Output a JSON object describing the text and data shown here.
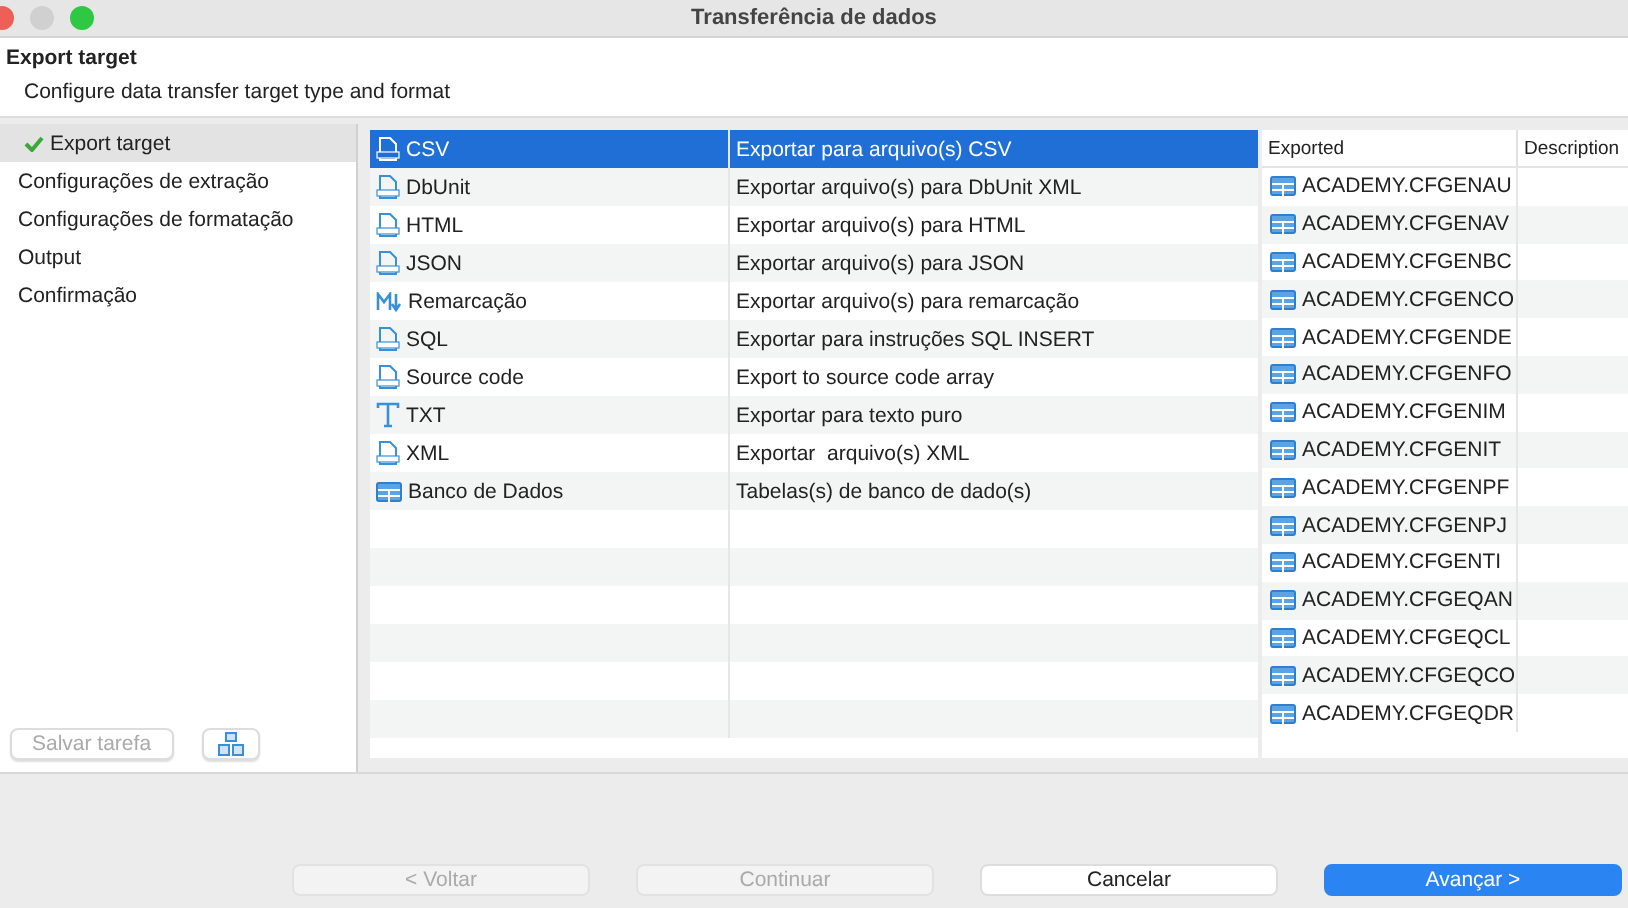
{
  "window": {
    "title": "Transferência de dados"
  },
  "header": {
    "title": "Export target",
    "subtitle": "Configure data transfer target type and format"
  },
  "steps": [
    {
      "label": "Export target",
      "selected": true,
      "checked": true
    },
    {
      "label": "Configurações de extração",
      "selected": false,
      "checked": false
    },
    {
      "label": "Configurações de formatação",
      "selected": false,
      "checked": false
    },
    {
      "label": "Output",
      "selected": false,
      "checked": false
    },
    {
      "label": "Confirmação",
      "selected": false,
      "checked": false
    }
  ],
  "task_buttons": {
    "save": {
      "label": "Salvar tarefa",
      "disabled": true
    }
  },
  "formats": [
    {
      "name": "CSV",
      "description": "Exportar para arquivo(s) CSV",
      "kind": "file",
      "selected": true
    },
    {
      "name": "DbUnit",
      "description": "Exportar arquivo(s) para DbUnit XML",
      "kind": "file",
      "selected": false
    },
    {
      "name": "HTML",
      "description": "Exportar arquivo(s) para HTML",
      "kind": "file",
      "selected": false
    },
    {
      "name": "JSON",
      "description": "Exportar arquivo(s) para JSON",
      "kind": "file",
      "selected": false
    },
    {
      "name": "Remarcação",
      "description": "Exportar arquivo(s) para remarcação",
      "kind": "markdown",
      "selected": false
    },
    {
      "name": "SQL",
      "description": "Exportar para instruções SQL INSERT",
      "kind": "file",
      "selected": false
    },
    {
      "name": "Source code",
      "description": "Export to source code array",
      "kind": "file",
      "selected": false
    },
    {
      "name": "TXT",
      "description": "Exportar para texto puro",
      "kind": "text",
      "selected": false
    },
    {
      "name": "XML",
      "description": "Exportar  arquivo(s) XML",
      "kind": "file",
      "selected": false
    },
    {
      "name": "Banco de Dados",
      "description": "Tabelas(s) de banco de dado(s)",
      "kind": "table",
      "selected": false
    }
  ],
  "exported": {
    "columns": [
      "Exported",
      "Description"
    ],
    "rows": [
      "ACADEMY.CFGENAU",
      "ACADEMY.CFGENAV",
      "ACADEMY.CFGENBC",
      "ACADEMY.CFGENCO",
      "ACADEMY.CFGENDE",
      "ACADEMY.CFGENFO",
      "ACADEMY.CFGENIM",
      "ACADEMY.CFGENIT",
      "ACADEMY.CFGENPF",
      "ACADEMY.CFGENPJ",
      "ACADEMY.CFGENTI",
      "ACADEMY.CFGEQAN",
      "ACADEMY.CFGEQCL",
      "ACADEMY.CFGEQCO",
      "ACADEMY.CFGEQDR"
    ]
  },
  "buttons": [
    {
      "label": "< Voltar",
      "kind": "normal",
      "disabled": true
    },
    {
      "label": "Continuar",
      "kind": "normal",
      "disabled": true
    },
    {
      "label": "Cancelar",
      "kind": "normal",
      "disabled": false
    },
    {
      "label": "Avançar >",
      "kind": "primary",
      "disabled": false
    }
  ]
}
